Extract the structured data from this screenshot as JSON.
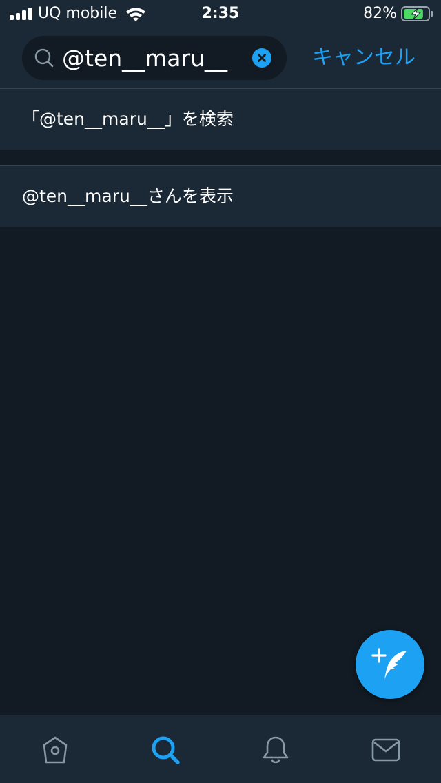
{
  "status_bar": {
    "carrier": "UQ mobile",
    "time": "2:35",
    "battery_percent": "82%",
    "battery_level": 0.82,
    "icons": [
      "signal-icon",
      "wifi-icon",
      "battery-charging-icon"
    ]
  },
  "search": {
    "value": "@ten__maru__",
    "icon": "search-icon",
    "clear_icon": "clear-icon",
    "cancel_label": "キャンセル"
  },
  "results": {
    "search_query": "「@ten__maru__」を検索",
    "view_profile": "@ten__maru__さんを表示"
  },
  "compose": {
    "icon": "compose-tweet-icon"
  },
  "tabs": [
    {
      "name": "home",
      "icon": "home-icon",
      "active": false
    },
    {
      "name": "search",
      "icon": "search-icon",
      "active": true
    },
    {
      "name": "notifications",
      "icon": "bell-icon",
      "active": false
    },
    {
      "name": "messages",
      "icon": "mail-icon",
      "active": false
    }
  ],
  "colors": {
    "accent": "#1da1f2",
    "background": "#121a23",
    "surface": "#1b2836",
    "divider": "#38444d",
    "inactive_icon": "#8899a6",
    "battery_fill": "#4cd964"
  }
}
